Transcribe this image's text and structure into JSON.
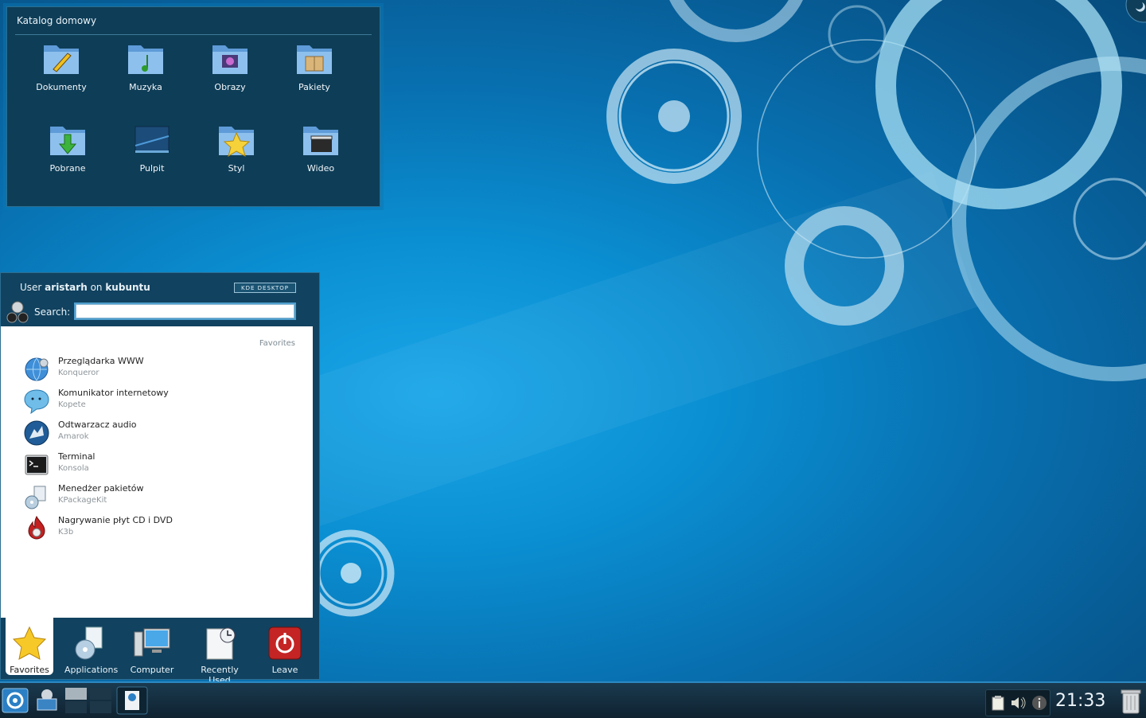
{
  "folderview": {
    "title": "Katalog domowy",
    "items": [
      {
        "label": "Dokumenty",
        "icon": "folder-documents-icon"
      },
      {
        "label": "Muzyka",
        "icon": "folder-music-icon"
      },
      {
        "label": "Obrazy",
        "icon": "folder-images-icon"
      },
      {
        "label": "Pakiety",
        "icon": "folder-packages-icon"
      },
      {
        "label": "Pobrane",
        "icon": "folder-downloads-icon"
      },
      {
        "label": "Pulpit",
        "icon": "desktop-folder-icon"
      },
      {
        "label": "Styl",
        "icon": "folder-style-icon"
      },
      {
        "label": "Wideo",
        "icon": "folder-video-icon"
      }
    ]
  },
  "kickoff": {
    "user_prefix": "User ",
    "user_name": "aristarh",
    "user_mid": " on ",
    "host": "kubuntu",
    "badge": "KDE DESKTOP",
    "search_label": "Search:",
    "search_value": "",
    "list_header": "Favorites",
    "favorites": [
      {
        "name": "Przeglądarka WWW",
        "app": "Konqueror",
        "icon": "konqueror-globe-icon"
      },
      {
        "name": "Komunikator internetowy",
        "app": "Kopete",
        "icon": "kopete-chat-icon"
      },
      {
        "name": "Odtwarzacz audio",
        "app": "Amarok",
        "icon": "amarok-wolf-icon"
      },
      {
        "name": "Terminal",
        "app": "Konsola",
        "icon": "terminal-icon"
      },
      {
        "name": "Menedżer pakietów",
        "app": "KPackageKit",
        "icon": "package-manager-icon"
      },
      {
        "name": "Nagrywanie płyt CD i DVD",
        "app": "K3b",
        "icon": "k3b-flame-icon"
      }
    ],
    "tabs": [
      {
        "label": "Favorites",
        "icon": "star-icon"
      },
      {
        "label": "Applications",
        "icon": "applications-icon"
      },
      {
        "label": "Computer",
        "icon": "computer-icon"
      },
      {
        "label": "Recently Used",
        "icon": "recent-documents-icon"
      },
      {
        "label": "Leave",
        "icon": "power-icon"
      }
    ]
  },
  "taskbar": {
    "clock": "21:33"
  },
  "colors": {
    "wallpaper": "#0a8fd2",
    "panel": "#11425f",
    "accent": "#2c89c2"
  }
}
